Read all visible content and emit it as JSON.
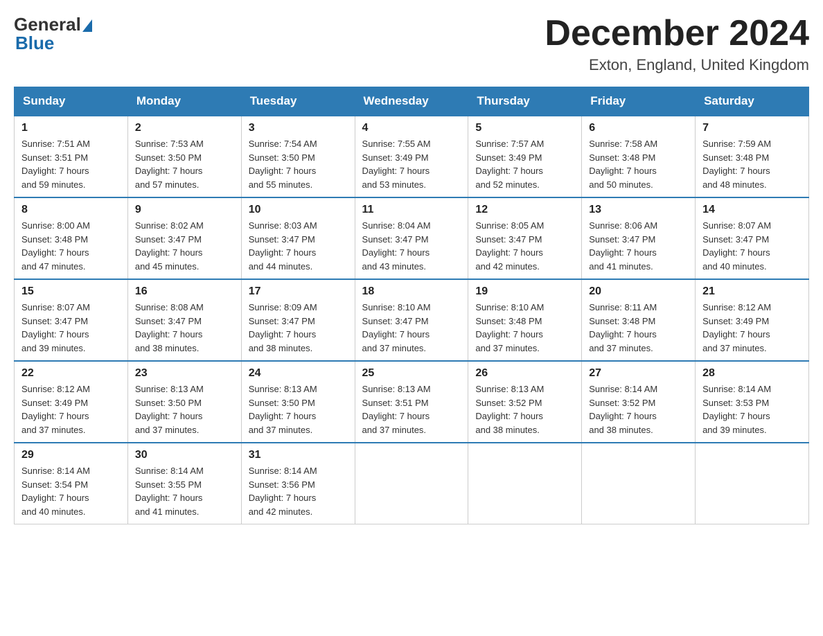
{
  "header": {
    "logo_general": "General",
    "logo_blue": "Blue",
    "title": "December 2024",
    "location": "Exton, England, United Kingdom"
  },
  "columns": [
    "Sunday",
    "Monday",
    "Tuesday",
    "Wednesday",
    "Thursday",
    "Friday",
    "Saturday"
  ],
  "weeks": [
    [
      {
        "day": "1",
        "info": "Sunrise: 7:51 AM\nSunset: 3:51 PM\nDaylight: 7 hours\nand 59 minutes."
      },
      {
        "day": "2",
        "info": "Sunrise: 7:53 AM\nSunset: 3:50 PM\nDaylight: 7 hours\nand 57 minutes."
      },
      {
        "day": "3",
        "info": "Sunrise: 7:54 AM\nSunset: 3:50 PM\nDaylight: 7 hours\nand 55 minutes."
      },
      {
        "day": "4",
        "info": "Sunrise: 7:55 AM\nSunset: 3:49 PM\nDaylight: 7 hours\nand 53 minutes."
      },
      {
        "day": "5",
        "info": "Sunrise: 7:57 AM\nSunset: 3:49 PM\nDaylight: 7 hours\nand 52 minutes."
      },
      {
        "day": "6",
        "info": "Sunrise: 7:58 AM\nSunset: 3:48 PM\nDaylight: 7 hours\nand 50 minutes."
      },
      {
        "day": "7",
        "info": "Sunrise: 7:59 AM\nSunset: 3:48 PM\nDaylight: 7 hours\nand 48 minutes."
      }
    ],
    [
      {
        "day": "8",
        "info": "Sunrise: 8:00 AM\nSunset: 3:48 PM\nDaylight: 7 hours\nand 47 minutes."
      },
      {
        "day": "9",
        "info": "Sunrise: 8:02 AM\nSunset: 3:47 PM\nDaylight: 7 hours\nand 45 minutes."
      },
      {
        "day": "10",
        "info": "Sunrise: 8:03 AM\nSunset: 3:47 PM\nDaylight: 7 hours\nand 44 minutes."
      },
      {
        "day": "11",
        "info": "Sunrise: 8:04 AM\nSunset: 3:47 PM\nDaylight: 7 hours\nand 43 minutes."
      },
      {
        "day": "12",
        "info": "Sunrise: 8:05 AM\nSunset: 3:47 PM\nDaylight: 7 hours\nand 42 minutes."
      },
      {
        "day": "13",
        "info": "Sunrise: 8:06 AM\nSunset: 3:47 PM\nDaylight: 7 hours\nand 41 minutes."
      },
      {
        "day": "14",
        "info": "Sunrise: 8:07 AM\nSunset: 3:47 PM\nDaylight: 7 hours\nand 40 minutes."
      }
    ],
    [
      {
        "day": "15",
        "info": "Sunrise: 8:07 AM\nSunset: 3:47 PM\nDaylight: 7 hours\nand 39 minutes."
      },
      {
        "day": "16",
        "info": "Sunrise: 8:08 AM\nSunset: 3:47 PM\nDaylight: 7 hours\nand 38 minutes."
      },
      {
        "day": "17",
        "info": "Sunrise: 8:09 AM\nSunset: 3:47 PM\nDaylight: 7 hours\nand 38 minutes."
      },
      {
        "day": "18",
        "info": "Sunrise: 8:10 AM\nSunset: 3:47 PM\nDaylight: 7 hours\nand 37 minutes."
      },
      {
        "day": "19",
        "info": "Sunrise: 8:10 AM\nSunset: 3:48 PM\nDaylight: 7 hours\nand 37 minutes."
      },
      {
        "day": "20",
        "info": "Sunrise: 8:11 AM\nSunset: 3:48 PM\nDaylight: 7 hours\nand 37 minutes."
      },
      {
        "day": "21",
        "info": "Sunrise: 8:12 AM\nSunset: 3:49 PM\nDaylight: 7 hours\nand 37 minutes."
      }
    ],
    [
      {
        "day": "22",
        "info": "Sunrise: 8:12 AM\nSunset: 3:49 PM\nDaylight: 7 hours\nand 37 minutes."
      },
      {
        "day": "23",
        "info": "Sunrise: 8:13 AM\nSunset: 3:50 PM\nDaylight: 7 hours\nand 37 minutes."
      },
      {
        "day": "24",
        "info": "Sunrise: 8:13 AM\nSunset: 3:50 PM\nDaylight: 7 hours\nand 37 minutes."
      },
      {
        "day": "25",
        "info": "Sunrise: 8:13 AM\nSunset: 3:51 PM\nDaylight: 7 hours\nand 37 minutes."
      },
      {
        "day": "26",
        "info": "Sunrise: 8:13 AM\nSunset: 3:52 PM\nDaylight: 7 hours\nand 38 minutes."
      },
      {
        "day": "27",
        "info": "Sunrise: 8:14 AM\nSunset: 3:52 PM\nDaylight: 7 hours\nand 38 minutes."
      },
      {
        "day": "28",
        "info": "Sunrise: 8:14 AM\nSunset: 3:53 PM\nDaylight: 7 hours\nand 39 minutes."
      }
    ],
    [
      {
        "day": "29",
        "info": "Sunrise: 8:14 AM\nSunset: 3:54 PM\nDaylight: 7 hours\nand 40 minutes."
      },
      {
        "day": "30",
        "info": "Sunrise: 8:14 AM\nSunset: 3:55 PM\nDaylight: 7 hours\nand 41 minutes."
      },
      {
        "day": "31",
        "info": "Sunrise: 8:14 AM\nSunset: 3:56 PM\nDaylight: 7 hours\nand 42 minutes."
      },
      null,
      null,
      null,
      null
    ]
  ]
}
